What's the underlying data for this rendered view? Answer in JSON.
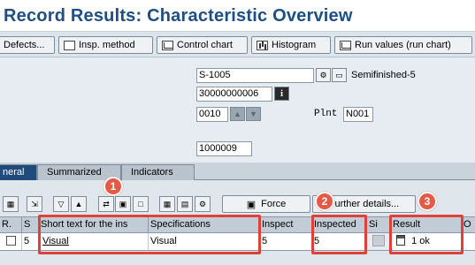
{
  "title": "Record Results: Characteristic Overview",
  "toolbar": {
    "defects": "Defects...",
    "insp_method": "Insp. method",
    "control_chart": "Control chart",
    "histogram": "Histogram",
    "run_values": "Run values (run chart)"
  },
  "form": {
    "material": "S-1005",
    "material_desc": "Semifinished-5",
    "inspection_lot": "30000000006",
    "operation": "0010",
    "plant_label": "Plnt",
    "plant_value": "N001",
    "number": "1000009",
    "info_icon_glyph": "i"
  },
  "tabs": [
    {
      "label": "neral",
      "active": true
    },
    {
      "label": "Summarized",
      "active": false
    },
    {
      "label": "Indicators",
      "active": false
    }
  ],
  "grid_toolbar": {
    "force": "Force",
    "further_details": "Further details..."
  },
  "columns": {
    "r": "R.",
    "s": "S",
    "short_text": "Short text for the ins",
    "specifications": "Specifications",
    "inspect": "Inspect",
    "inspected": "Inspected",
    "si": "Si",
    "result": "Result",
    "o": "O"
  },
  "row": {
    "s": "5",
    "short_text": "Visual",
    "specifications": "Visual",
    "inspect": "5",
    "inspected": "5",
    "result": "1 ok"
  },
  "markers": [
    "1",
    "2",
    "3"
  ],
  "colors": {
    "title": "#1d4f86",
    "highlight": "#e0403a",
    "active_tab": "#1f4c7a"
  }
}
